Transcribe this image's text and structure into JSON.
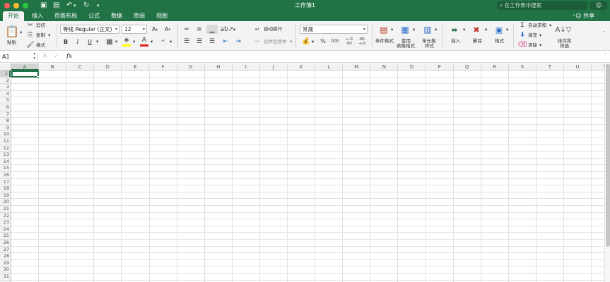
{
  "window": {
    "title": "工作簿1",
    "search_placeholder": "在工作表中搜索"
  },
  "colors": {
    "brand": "#217346",
    "close": "#fd5d57",
    "minimize": "#febb2e",
    "zoom": "#29c840"
  },
  "tabs": [
    {
      "label": "开始",
      "active": true
    },
    {
      "label": "插入"
    },
    {
      "label": "页面布局"
    },
    {
      "label": "公式"
    },
    {
      "label": "数据"
    },
    {
      "label": "审阅"
    },
    {
      "label": "视图"
    }
  ],
  "share_label": "共享",
  "ribbon": {
    "paste": "粘贴",
    "cut": "剪切",
    "copy": "复制",
    "format_painter": "格式",
    "font_name": "等线 Regular (正文)",
    "font_size": "12",
    "bold": "B",
    "italic": "I",
    "underline": "U",
    "wrap_text": "自动换行",
    "merge_center": "合并后居中",
    "number_format": "常规",
    "percent": "%",
    "comma": "000",
    "conditional_format": "条件格式",
    "format_as_table_1": "套用",
    "format_as_table_2": "表格格式",
    "cell_styles_1": "单元格",
    "cell_styles_2": "样式",
    "insert": "插入",
    "delete": "删除",
    "format": "格式",
    "autosum": "自动求和",
    "fill": "填充",
    "clear": "清除",
    "sort_filter_1": "排序和",
    "sort_filter_2": "筛选"
  },
  "formula_bar": {
    "name_box": "A1",
    "fx": "fx",
    "formula": ""
  },
  "columns": [
    "A",
    "B",
    "C",
    "D",
    "E",
    "F",
    "G",
    "H",
    "I",
    "J",
    "K",
    "L",
    "M",
    "N",
    "O",
    "P",
    "Q",
    "R",
    "S",
    "T",
    "U",
    "V"
  ],
  "rows": [
    "1",
    "2",
    "3",
    "4",
    "5",
    "6",
    "7",
    "8",
    "9",
    "10",
    "11",
    "12",
    "13",
    "14",
    "15",
    "16",
    "17",
    "18",
    "19",
    "20",
    "21",
    "22",
    "23",
    "24",
    "25",
    "26",
    "27",
    "28",
    "29",
    "30",
    "31"
  ],
  "active_cell": "A1"
}
